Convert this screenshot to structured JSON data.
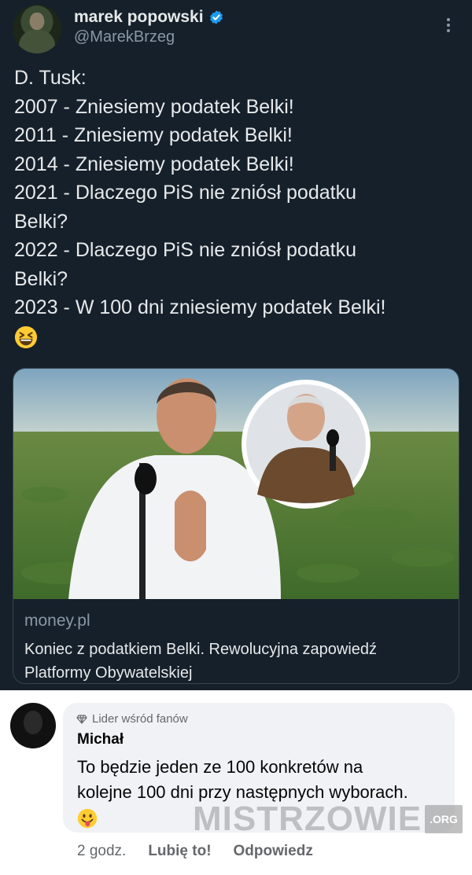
{
  "tweet": {
    "display_name": "marek popowski",
    "handle": "@MarekBrzeg",
    "lines": [
      "D. Tusk:",
      "2007 - Zniesiemy podatek Belki!",
      "2011 - Zniesiemy podatek Belki!",
      "2014 - Zniesiemy podatek Belki!",
      "2021 - Dlaczego PiS nie zniósł podatku",
      "Belki?",
      "2022 - Dlaczego PiS nie zniósł podatku",
      "Belki?",
      "2023 - W 100 dni zniesiemy podatek Belki!"
    ],
    "end_emoji": "grinning-squinting-face",
    "card": {
      "domain": "money.pl",
      "title": "Koniec z podatkiem Belki. Rewolucyjna zapowiedź Platformy Obywatelskiej"
    }
  },
  "comment": {
    "badge": "Lider wśród fanów",
    "author": "Michał",
    "text": "To będzie jeden ze 100 konkretów na kolejne 100 dni przy następnych wyborach.",
    "emoji": "face-with-tongue",
    "watermark": "MISTRZOWIE",
    "watermark_tld": ".ORG",
    "time": "2 godz.",
    "like_label": "Lubię to!",
    "reply_label": "Odpowiedz"
  },
  "colors": {
    "tweet_bg": "#15202b",
    "verified": "#1d9bf0",
    "comment_bubble": "#f0f2f5"
  }
}
